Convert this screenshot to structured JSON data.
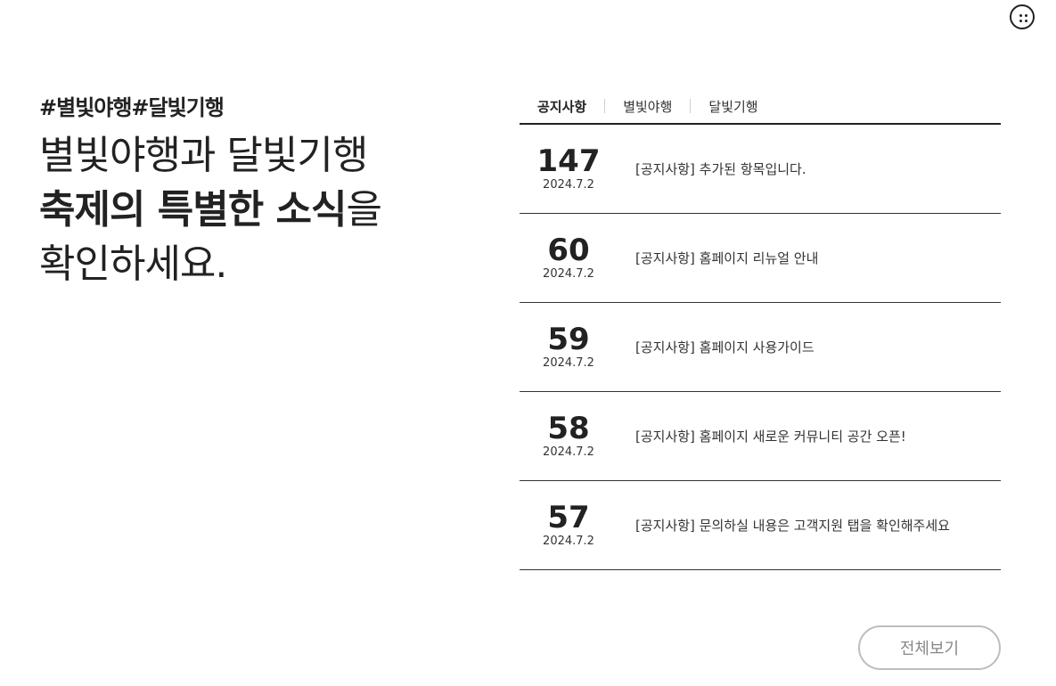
{
  "hero": {
    "hashtag": "#별빛야행#달빛기행",
    "line1": "별빛야행과 달빛기행",
    "line2_strong": "축제의 특별한 소식",
    "line2_rest": "을",
    "line3": "확인하세요."
  },
  "header": {
    "menu_icon": "grid-dots-icon"
  },
  "tabs": [
    {
      "label": "공지사항",
      "active": true
    },
    {
      "label": "별빛야행",
      "active": false
    },
    {
      "label": "달빛기행",
      "active": false
    }
  ],
  "notices": [
    {
      "num": "147",
      "date": "2024.7.2",
      "title": "[공지사항] 추가된 항목입니다."
    },
    {
      "num": "60",
      "date": "2024.7.2",
      "title": "[공지사항] 홈페이지 리뉴얼 안내"
    },
    {
      "num": "59",
      "date": "2024.7.2",
      "title": "[공지사항] 홈페이지 사용가이드"
    },
    {
      "num": "58",
      "date": "2024.7.2",
      "title": "[공지사항] 홈페이지 새로운 커뮤니티 공간 오픈!"
    },
    {
      "num": "57",
      "date": "2024.7.2",
      "title": "[공지사항] 문의하실 내용은 고객지원 탭을 확인해주세요"
    }
  ],
  "view_all_label": "전체보기"
}
